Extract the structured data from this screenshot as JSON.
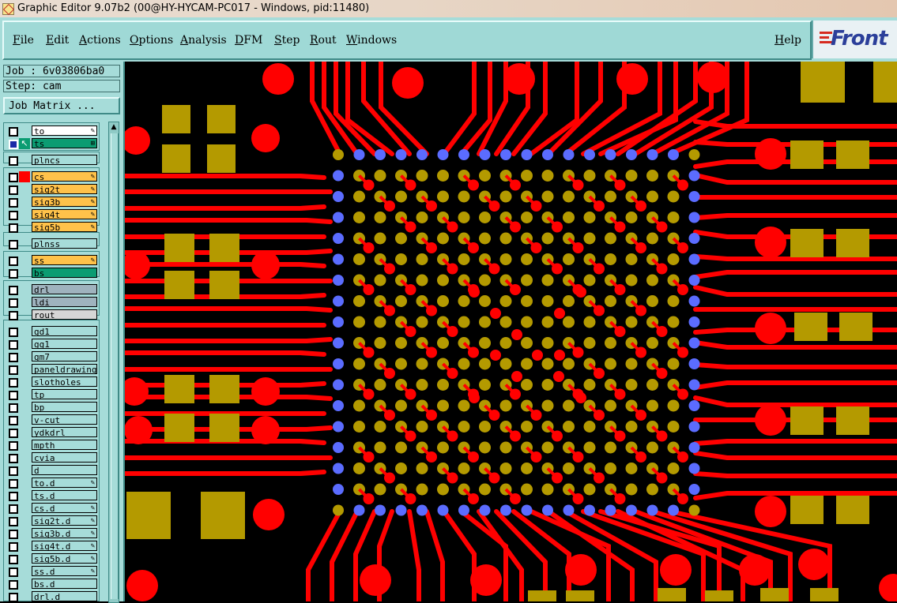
{
  "window": {
    "title": "Graphic Editor 9.07b2 (00@HY-HYCAM-PC017 - Windows, pid:11480)"
  },
  "menu": {
    "items": [
      "File",
      "Edit",
      "Actions",
      "Options",
      "Analysis",
      "DFM",
      "Step",
      "Rout",
      "Windows"
    ],
    "help": "Help"
  },
  "logo": {
    "text": "Front"
  },
  "job": {
    "label": "Job : 6v03806ba0",
    "step": "Step: cam",
    "matrix_button": "Job Matrix ..."
  },
  "colors": {
    "panel": "#a6dcd9",
    "trace": "#ff0000",
    "pad_gold": "#b49a00",
    "pad_blue": "#5b6cff",
    "orange_layer": "#ffc24a",
    "green_layer": "#0b9c72",
    "gray_layer": "#9fb3be"
  },
  "layers": [
    {
      "name": "to",
      "color": "#ffffff",
      "flag": "✎"
    },
    {
      "name": "ts",
      "color": "#0b9c72",
      "flag": "⊞",
      "active": true
    },
    {
      "name": "plncs",
      "color": "#a6dcd9"
    },
    {
      "name": "cs",
      "color": "#ffc24a",
      "flag": "✎",
      "swatch": "#ff0000"
    },
    {
      "name": "sig2t",
      "color": "#ffc24a",
      "flag": "✎"
    },
    {
      "name": "sig3b",
      "color": "#ffc24a",
      "flag": "✎"
    },
    {
      "name": "sig4t",
      "color": "#ffc24a",
      "flag": "✎"
    },
    {
      "name": "sig5b",
      "color": "#ffc24a",
      "flag": "✎"
    },
    {
      "name": "plnss",
      "color": "#a6dcd9"
    },
    {
      "name": "ss",
      "color": "#ffc24a",
      "flag": "✎"
    },
    {
      "name": "bs",
      "color": "#0b9c72"
    },
    {
      "name": "drl",
      "color": "#9fb3be"
    },
    {
      "name": "ldi",
      "color": "#9fb3be"
    },
    {
      "name": "rout",
      "color": "#d6d6d6"
    },
    {
      "name": "gd1",
      "color": "#a6dcd9"
    },
    {
      "name": "gg1",
      "color": "#a6dcd9"
    },
    {
      "name": "gm7",
      "color": "#a6dcd9"
    },
    {
      "name": "paneldrawing",
      "color": "#a6dcd9"
    },
    {
      "name": "slotholes",
      "color": "#a6dcd9"
    },
    {
      "name": "tp",
      "color": "#a6dcd9"
    },
    {
      "name": "bp",
      "color": "#a6dcd9"
    },
    {
      "name": "v-cut",
      "color": "#a6dcd9"
    },
    {
      "name": "ydkdrl",
      "color": "#a6dcd9"
    },
    {
      "name": "mpth",
      "color": "#a6dcd9"
    },
    {
      "name": "cvia",
      "color": "#a6dcd9"
    },
    {
      "name": "d",
      "color": "#a6dcd9"
    },
    {
      "name": "to.d",
      "color": "#a6dcd9",
      "flag": "✎"
    },
    {
      "name": "ts.d",
      "color": "#a6dcd9"
    },
    {
      "name": "cs.d",
      "color": "#a6dcd9",
      "flag": "✎"
    },
    {
      "name": "sig2t.d",
      "color": "#a6dcd9",
      "flag": "✎"
    },
    {
      "name": "sig3b.d",
      "color": "#a6dcd9",
      "flag": "✎"
    },
    {
      "name": "sig4t.d",
      "color": "#a6dcd9",
      "flag": "✎"
    },
    {
      "name": "sig5b.d",
      "color": "#a6dcd9",
      "flag": "✎"
    },
    {
      "name": "ss.d",
      "color": "#a6dcd9",
      "flag": "✎"
    },
    {
      "name": "bs.d",
      "color": "#a6dcd9"
    },
    {
      "name": "drl.d",
      "color": "#a6dcd9"
    }
  ]
}
